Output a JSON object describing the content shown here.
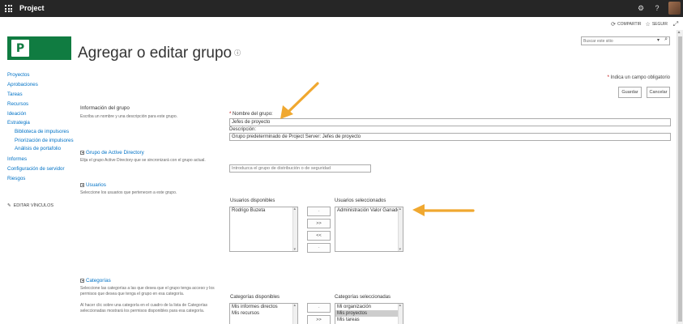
{
  "suitebar": {
    "app_title": "Project",
    "icons": [
      "waffle-icon",
      "gear-icon",
      "help-icon",
      "avatar"
    ]
  },
  "actions": {
    "share_label": "COMPARTIR",
    "follow_label": "SEGUIR"
  },
  "logo": {
    "letter": "P"
  },
  "page": {
    "title": "Agregar o editar grupo",
    "info_glyph": "ⓘ"
  },
  "search": {
    "placeholder": "Buscar este sitio"
  },
  "nav": {
    "items": [
      {
        "label": "Proyectos"
      },
      {
        "label": "Aprobaciones"
      },
      {
        "label": "Tareas"
      },
      {
        "label": "Recursos"
      },
      {
        "label": "Ideación"
      },
      {
        "label": "Estrategia"
      }
    ],
    "sub_items": [
      {
        "label": "Biblioteca de impulsores"
      },
      {
        "label": "Priorización de impulsores"
      },
      {
        "label": "Análisis de portafolio"
      }
    ],
    "bottom_items": [
      {
        "label": "Informes"
      },
      {
        "label": "Configuración de servidor"
      },
      {
        "label": "Riesgos"
      }
    ],
    "edit_links": "EDITAR VÍNCULOS"
  },
  "form": {
    "required_note": "Indica un campo obligatorio",
    "save_label": "Guardar",
    "cancel_label": "Cancelar",
    "group_info": {
      "heading": "Información del grupo",
      "description": "Escriba un nombre y una descripción para este grupo.",
      "name_label": "Nombre del grupo:",
      "name_value": "Jefes de proyecto",
      "desc_label": "Descripción:",
      "desc_value": "Grupo predeterminado de Project Server: Jefes de proyecto"
    },
    "ad_group": {
      "heading": "Grupo de Active Directory",
      "description": "Elija el grupo Active Directory que se sincronizará con el grupo actual.",
      "placeholder": "Introduzca el grupo de distribución o de seguridad"
    },
    "users": {
      "heading": "Usuarios",
      "description": "Seleccione los usuarios que pertenecen a este grupo.",
      "available_label": "Usuarios disponibles",
      "available": [
        "Rodrigo Buzeta"
      ],
      "selected_label": "Usuarios seleccionados",
      "selected": [
        "Administración Valor Ganado"
      ],
      "buttons": [
        "-",
        ">>",
        "<<",
        "-"
      ]
    },
    "categories": {
      "heading": "Categorías",
      "description1": "Seleccione las categorías a las que desea que el grupo tenga acceso y los permisos que desea que tenga el grupo en esa categoría.",
      "description2": "Al hacer clic sobre una categoría en el cuadro de la lista de Categorías seleccionadas mostrará los permisos disponibles para esa categoría.",
      "available_label": "Categorías disponibles",
      "available": [
        "Mis informes directos",
        "Mis recursos"
      ],
      "selected_label": "Categorías seleccionadas",
      "selected": [
        "Mi organización",
        "Mis proyectos",
        "Mis tareas"
      ],
      "buttons": [
        "-",
        ">>"
      ]
    }
  },
  "colors": {
    "suitebar": "#262626",
    "brand": "#107c41",
    "link": "#0072c6",
    "annotation_arrow": "#f0a830"
  }
}
